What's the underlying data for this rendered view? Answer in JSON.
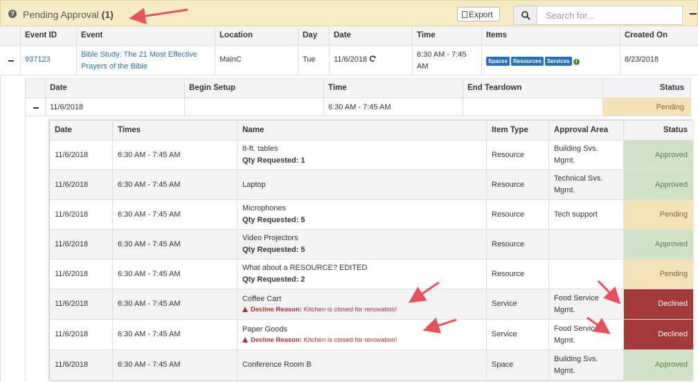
{
  "header": {
    "title": "Pending Approval",
    "count": "(1)",
    "export_label": "Export",
    "search_placeholder": "Search for..."
  },
  "main_table": {
    "columns": [
      "Event ID",
      "Event",
      "Location",
      "Day",
      "Date",
      "Time",
      "Items",
      "Created On"
    ],
    "row": {
      "event_id": "937123",
      "event_line1": "Bible Study: The 21 Most Effective",
      "event_line2": "Prayers of the Bible",
      "location": "MainC",
      "day": "Tue",
      "date": "11/6/2018",
      "time_line1": "6:30 AM - 7:45",
      "time_line2": "AM",
      "items": [
        "Spaces",
        "Resources",
        "Services"
      ],
      "created_on": "8/23/2018"
    }
  },
  "occurrence_table": {
    "columns": [
      "Date",
      "Begin Setup",
      "Time",
      "End Teardown",
      "Status"
    ],
    "row": {
      "date": "11/6/2018",
      "begin_setup": "",
      "time": "6:30 AM - 7:45 AM",
      "end_teardown": "",
      "status": "Pending"
    }
  },
  "detail_table": {
    "columns": [
      "Date",
      "Times",
      "Name",
      "Item Type",
      "Approval Area",
      "Status"
    ],
    "qty_label": "Qty Requested:",
    "decline_label": "Decline Reason:",
    "rows": [
      {
        "date": "11/6/2018",
        "times": "6:30 AM - 7:45 AM",
        "name": "8-ft. tables",
        "qty": "Qty Requested: 1",
        "decline": "",
        "type": "Resource",
        "area1": "Building Svs.",
        "area2": "Mgmt.",
        "status": "Approved"
      },
      {
        "date": "11/6/2018",
        "times": "6:30 AM - 7:45 AM",
        "name": "Laptop",
        "qty": "",
        "decline": "",
        "type": "Resource",
        "area1": "Technical Svs.",
        "area2": "Mgmt.",
        "status": "Approved"
      },
      {
        "date": "11/6/2018",
        "times": "6:30 AM - 7:45 AM",
        "name": "Microphones",
        "qty": "Qty Requested: 5",
        "decline": "",
        "type": "Resource",
        "area1": "Tech support",
        "area2": "",
        "status": "Pending"
      },
      {
        "date": "11/6/2018",
        "times": "6:30 AM - 7:45 AM",
        "name": "Video Projectors",
        "qty": "Qty Requested: 5",
        "decline": "",
        "type": "Resource",
        "area1": "",
        "area2": "",
        "status": "Approved"
      },
      {
        "date": "11/6/2018",
        "times": "6:30 AM - 7:45 AM",
        "name": "What about a RESOURCE? EDITED",
        "qty": "Qty Requested: 2",
        "decline": "",
        "type": "Resource",
        "area1": "",
        "area2": "",
        "status": "Pending"
      },
      {
        "date": "11/6/2018",
        "times": "6:30 AM - 7:45 AM",
        "name": "Coffee Cart",
        "qty": "",
        "decline": "Kitchen is closed for renovation!",
        "type": "Service",
        "area1": "Food Service",
        "area2": "Mgmt.",
        "status": "Declined"
      },
      {
        "date": "11/6/2018",
        "times": "6:30 AM - 7:45 AM",
        "name": "Paper Goods",
        "qty": "",
        "decline": "Kitchen is closed for renovation!",
        "type": "Service",
        "area1": "Food Service",
        "area2": "Mgmt.",
        "status": "Declined"
      },
      {
        "date": "11/6/2018",
        "times": "6:30 AM - 7:45 AM",
        "name": "Conference Room B",
        "qty": "",
        "decline": "",
        "type": "Space",
        "area1": "Building Svs.",
        "area2": "Mgmt.",
        "status": "Approved"
      }
    ]
  },
  "colors": {
    "header_bg": "#f7ecc5",
    "link": "#2a6cb0",
    "badge": "#2570b8",
    "approved_bg": "#cfe3c6",
    "pending_bg": "#f3e3b5",
    "declined_bg": "#a33a3a",
    "annotation_arrow": "#e8505b"
  }
}
